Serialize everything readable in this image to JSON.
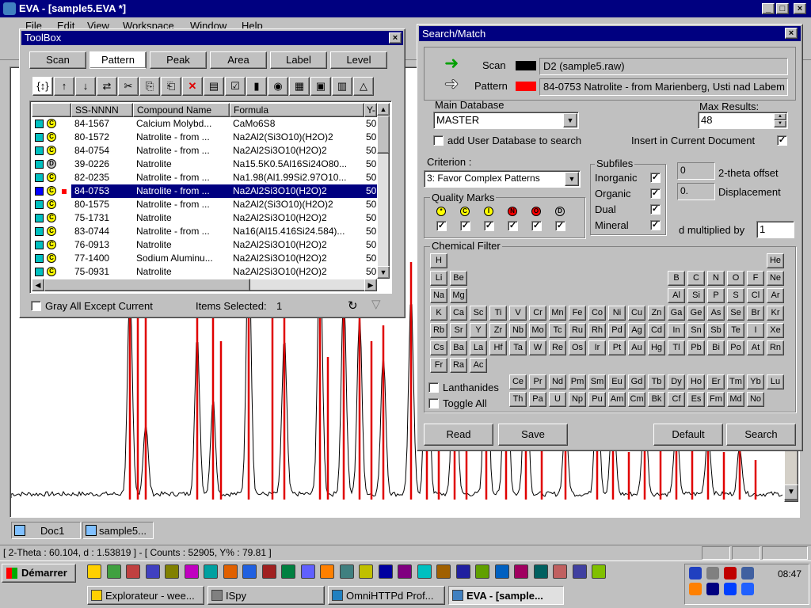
{
  "app": {
    "title": "EVA - [sample5.EVA *]",
    "menu": [
      "File",
      "Edit",
      "View",
      "Workspace",
      "Window",
      "Help"
    ]
  },
  "toolbox": {
    "title": "ToolBox",
    "tabs": [
      "Scan",
      "Pattern",
      "Peak",
      "Area",
      "Label",
      "Level"
    ],
    "active_tab": "Pattern",
    "columns": [
      "SS-NNNN",
      "Compound Name",
      "Formula",
      "Y-"
    ],
    "rows": [
      {
        "id": "84-1567",
        "name": "Calcium Molybd...",
        "formula": "CaMo6S8",
        "y": "50",
        "q": "C",
        "color": "#00c0c0"
      },
      {
        "id": "80-1572",
        "name": "Natrolite - from ...",
        "formula": "Na2Al2(Si3O10)(H2O)2",
        "y": "50",
        "q": "C",
        "color": "#00c0c0"
      },
      {
        "id": "84-0754",
        "name": "Natrolite - from ...",
        "formula": "Na2Al2Si3O10(H2O)2",
        "y": "50",
        "q": "C",
        "color": "#00c0c0"
      },
      {
        "id": "39-0226",
        "name": "Natrolite",
        "formula": "Na15.5K0.5Al16Si24O80...",
        "y": "50",
        "q": "D",
        "color": "#00c0c0"
      },
      {
        "id": "82-0235",
        "name": "Natrolite - from ...",
        "formula": "Na1.98(Al1.99Si2.97O10...",
        "y": "50",
        "q": "C",
        "color": "#00c0c0"
      },
      {
        "id": "84-0753",
        "name": "Natrolite - from ...",
        "formula": "Na2Al2Si3O10(H2O)2",
        "y": "50",
        "q": "C",
        "color": "#0000ff",
        "selected": true
      },
      {
        "id": "80-1575",
        "name": "Natrolite - from ...",
        "formula": "Na2Al2(Si3O10)(H2O)2",
        "y": "50",
        "q": "C",
        "color": "#00c0c0"
      },
      {
        "id": "75-1731",
        "name": "Natrolite",
        "formula": "Na2Al2Si3O10(H2O)2",
        "y": "50",
        "q": "C",
        "color": "#00c0c0"
      },
      {
        "id": "83-0744",
        "name": "Natrolite - from ...",
        "formula": "Na16(Al15.416Si24.584)...",
        "y": "50",
        "q": "C",
        "color": "#00c0c0"
      },
      {
        "id": "76-0913",
        "name": "Natrolite",
        "formula": "Na2Al2Si3O10(H2O)2",
        "y": "50",
        "q": "C",
        "color": "#00c0c0"
      },
      {
        "id": "77-1400",
        "name": "Sodium Aluminu...",
        "formula": "Na2Al2Si3O10(H2O)2",
        "y": "50",
        "q": "C",
        "color": "#00c0c0"
      },
      {
        "id": "75-0931",
        "name": "Natrolite",
        "formula": "Na2Al2Si3O10(H2O)2",
        "y": "50",
        "q": "C",
        "color": "#00c0c0"
      }
    ],
    "gray_all_label": "Gray All Except Current",
    "items_selected_label": "Items Selected:",
    "items_selected_value": "1"
  },
  "search": {
    "title": "Search/Match",
    "scan_label": "Scan",
    "scan_value": "D2 (sample5.raw)",
    "pattern_label": "Pattern",
    "pattern_value": "84-0753 Natrolite - from Marienberg, Usti nad Labem",
    "main_db_label": "Main Database",
    "main_db_value": "MASTER",
    "max_results_label": "Max Results:",
    "max_results_value": "48",
    "add_user_db_label": "add User Database to search",
    "insert_doc_label": "Insert in Current Document",
    "criterion_label": "Criterion :",
    "criterion_value": "3: Favor Complex Patterns",
    "subfiles_label": "Subfiles",
    "subfiles": [
      "Inorganic",
      "Organic",
      "Dual",
      "Mineral"
    ],
    "two_theta_value": "0",
    "two_theta_label": "2-theta offset",
    "displacement_value": "0.",
    "displacement_label": "Displacement",
    "quality_label": "Quality Marks",
    "quality_marks": [
      {
        "letter": "*",
        "color": "#ffff00"
      },
      {
        "letter": "C",
        "color": "#ffff00"
      },
      {
        "letter": "I",
        "color": "#ffff00"
      },
      {
        "letter": "N",
        "color": "#ff0000"
      },
      {
        "letter": "O",
        "color": "#ff0000"
      },
      {
        "letter": "D",
        "color": "#c0c0c0"
      }
    ],
    "d_mult_label": "d multiplied by",
    "d_mult_value": "1",
    "chem_filter_label": "Chemical Filter",
    "lanthanides_label": "Lanthanides",
    "toggle_all_label": "Toggle All",
    "buttons": {
      "read": "Read",
      "save": "Save",
      "default": "Default",
      "search": "Search"
    }
  },
  "periodic": {
    "rows": [
      [
        "H",
        "",
        "",
        "",
        "",
        "",
        "",
        "",
        "",
        "",
        "",
        "",
        "",
        "",
        "",
        "",
        "",
        "He"
      ],
      [
        "Li",
        "Be",
        "",
        "",
        "",
        "",
        "",
        "",
        "",
        "",
        "",
        "",
        "B",
        "C",
        "N",
        "O",
        "F",
        "Ne"
      ],
      [
        "Na",
        "Mg",
        "",
        "",
        "",
        "",
        "",
        "",
        "",
        "",
        "",
        "",
        "Al",
        "Si",
        "P",
        "S",
        "Cl",
        "Ar"
      ],
      [
        "K",
        "Ca",
        "Sc",
        "Ti",
        "V",
        "Cr",
        "Mn",
        "Fe",
        "Co",
        "Ni",
        "Cu",
        "Zn",
        "Ga",
        "Ge",
        "As",
        "Se",
        "Br",
        "Kr"
      ],
      [
        "Rb",
        "Sr",
        "Y",
        "Zr",
        "Nb",
        "Mo",
        "Tc",
        "Ru",
        "Rh",
        "Pd",
        "Ag",
        "Cd",
        "In",
        "Sn",
        "Sb",
        "Te",
        "I",
        "Xe"
      ],
      [
        "Cs",
        "Ba",
        "La",
        "Hf",
        "Ta",
        "W",
        "Re",
        "Os",
        "Ir",
        "Pt",
        "Au",
        "Hg",
        "Tl",
        "Pb",
        "Bi",
        "Po",
        "At",
        "Rn"
      ],
      [
        "Fr",
        "Ra",
        "Ac"
      ]
    ],
    "lanthanides": [
      "Ce",
      "Pr",
      "Nd",
      "Pm",
      "Sm",
      "Eu",
      "Gd",
      "Tb",
      "Dy",
      "Ho",
      "Er",
      "Tm",
      "Yb",
      "Lu"
    ],
    "actinides": [
      "Th",
      "Pa",
      "U",
      "Np",
      "Pu",
      "Am",
      "Cm",
      "Bk",
      "Cf",
      "Es",
      "Fm",
      "Md",
      "No"
    ]
  },
  "doc_tabs": [
    "Doc1",
    "sample5..."
  ],
  "status": "[ 2-Theta : 60.104, d : 1.53819 ] - [ Counts : 52905, Y% : 79.81 ]",
  "taskbar": {
    "start": "Démarrer",
    "tasks": [
      "Explorateur - wee...",
      "ISpy",
      "OmniHTTPd Prof...",
      "EVA - [sample..."
    ],
    "time": "08:47"
  }
}
